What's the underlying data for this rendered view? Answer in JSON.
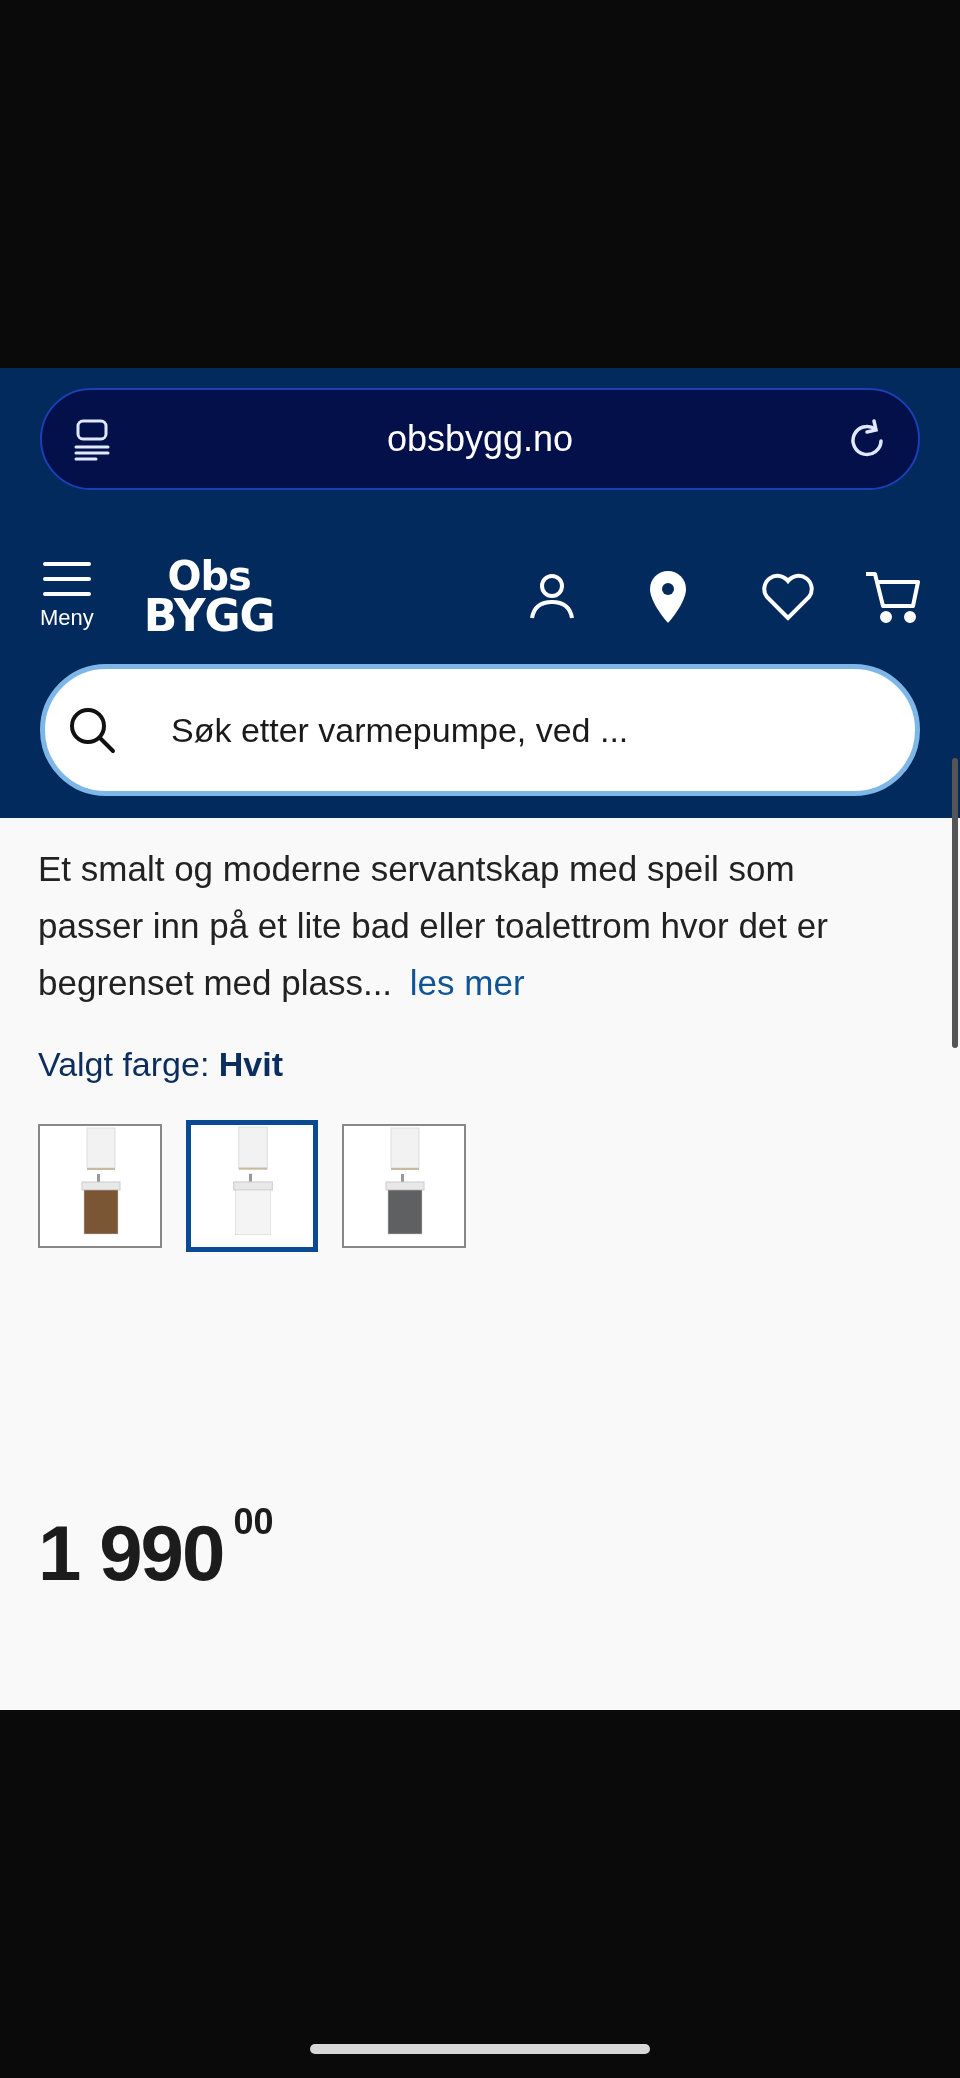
{
  "browser": {
    "url": "obsbygg.no"
  },
  "header": {
    "menu_label": "Meny",
    "logo_top": "Obs",
    "logo_bottom": "BYGG",
    "search": {
      "placeholder": "Søk etter varmepumpe, ved ..."
    }
  },
  "description": {
    "text": "Et smalt og moderne servantskap med speil som passer inn på et lite bad eller toalettrom hvor det er begrenset med plass...",
    "link": "les mer"
  },
  "color_picker": {
    "label": "Valgt farge:",
    "value": "Hvit",
    "options": [
      {
        "selected": false,
        "color": "#7a5634"
      },
      {
        "selected": true,
        "color": "#f4f4f4"
      },
      {
        "selected": false,
        "color": "#5f6062"
      }
    ]
  },
  "price": {
    "whole": "1 990",
    "decimals": "00"
  }
}
